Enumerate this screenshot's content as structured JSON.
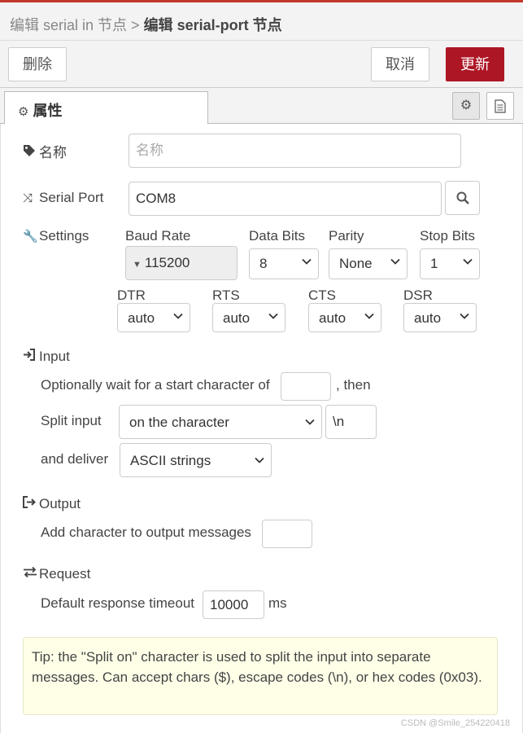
{
  "header": {
    "breadcrumb_parent": "编辑 serial in 节点 >",
    "breadcrumb_current": "编辑 serial-port 节点"
  },
  "toolbar": {
    "delete_label": "删除",
    "cancel_label": "取消",
    "update_label": "更新"
  },
  "tabs": {
    "properties_label": "属性"
  },
  "form": {
    "name": {
      "label": "名称",
      "placeholder": "名称",
      "value": ""
    },
    "serial_port": {
      "label": "Serial Port",
      "value": "COM8"
    },
    "settings": {
      "label": "Settings",
      "baud_rate": {
        "label": "Baud Rate",
        "value": "115200"
      },
      "data_bits": {
        "label": "Data Bits",
        "value": "8"
      },
      "parity": {
        "label": "Parity",
        "value": "None"
      },
      "stop_bits": {
        "label": "Stop Bits",
        "value": "1"
      },
      "dtr": {
        "label": "DTR",
        "value": "auto"
      },
      "rts": {
        "label": "RTS",
        "value": "auto"
      },
      "cts": {
        "label": "CTS",
        "value": "auto"
      },
      "dsr": {
        "label": "DSR",
        "value": "auto"
      }
    },
    "input": {
      "label": "Input",
      "wait_text": "Optionally wait for a start character of",
      "wait_value": "",
      "then_text": ", then",
      "split_label": "Split input",
      "split_mode": "on the character",
      "split_value": "\\n",
      "deliver_label": "and deliver",
      "deliver_value": "ASCII strings"
    },
    "output": {
      "label": "Output",
      "add_char_text": "Add character to output messages",
      "add_char_value": ""
    },
    "request": {
      "label": "Request",
      "timeout_text": "Default response timeout",
      "timeout_value": "10000",
      "unit": "ms"
    }
  },
  "tip": "Tip: the \"Split on\" character is used to split the input into separate messages. Can accept chars ($), escape codes (\\n), or hex codes (0x03).",
  "watermark": "CSDN @Smile_254220418",
  "colors": {
    "accent": "#ad1625",
    "tip_background": "#ffffe8"
  }
}
